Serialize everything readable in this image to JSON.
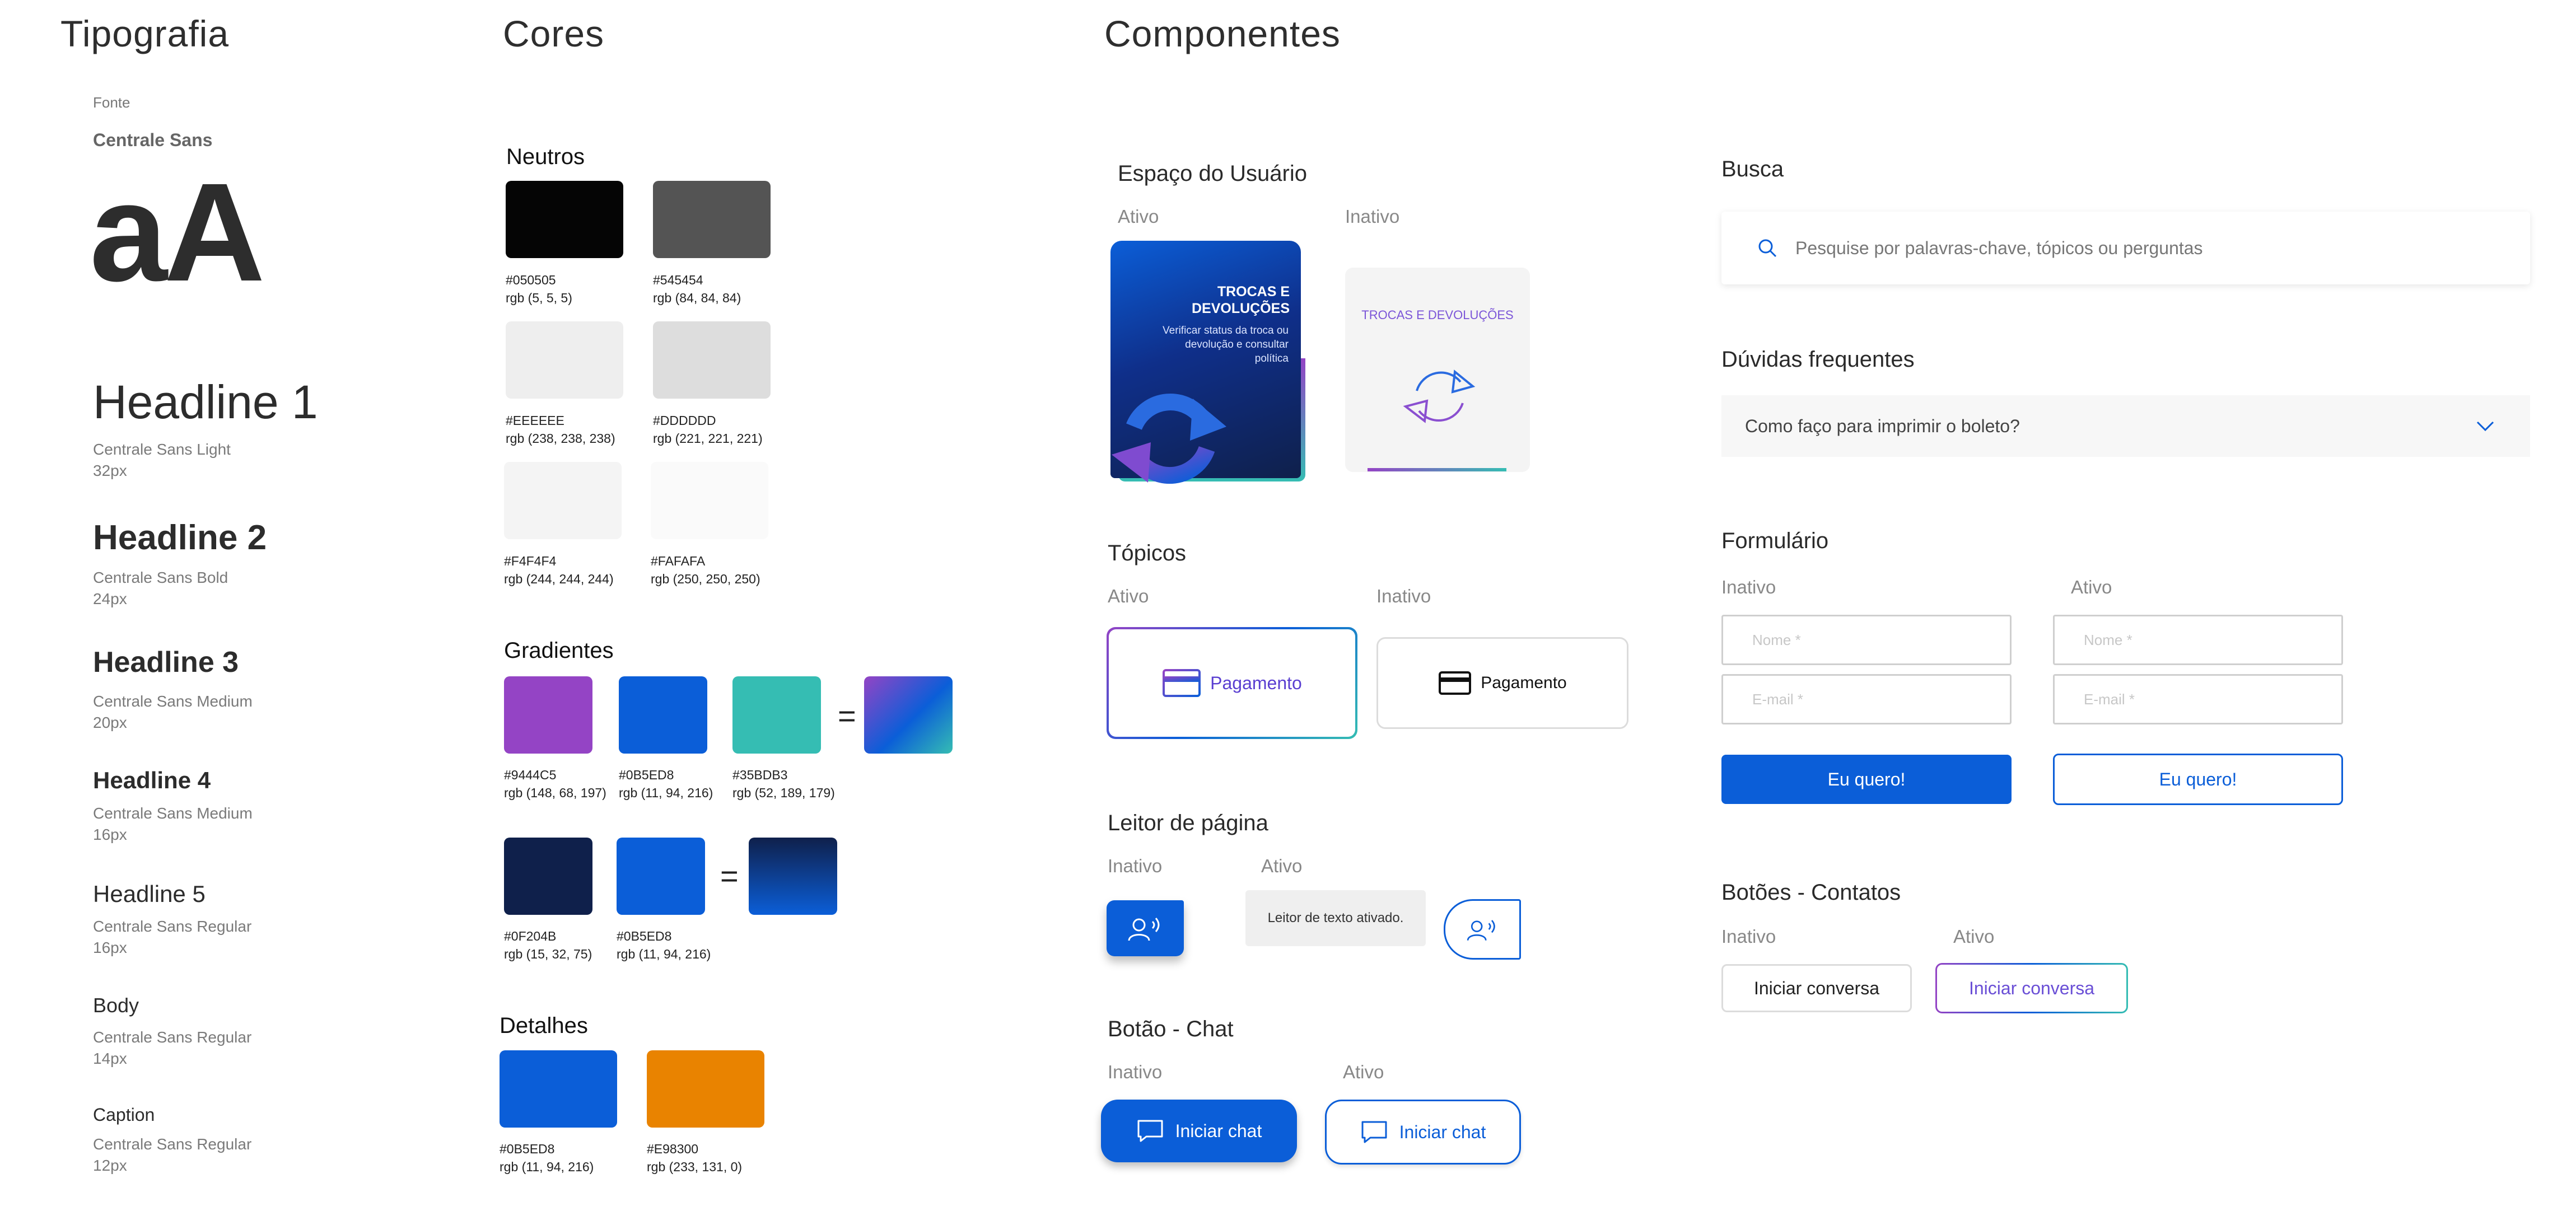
{
  "typography": {
    "title": "Tipografia",
    "font_label": "Fonte",
    "font_name": "Centrale Sans",
    "specimen": "aA",
    "styles": [
      {
        "name": "Headline 1",
        "weight": "Centrale Sans Light",
        "size": "32px"
      },
      {
        "name": "Headline 2",
        "weight": "Centrale Sans Bold",
        "size": "24px"
      },
      {
        "name": "Headline 3",
        "weight": "Centrale Sans Medium",
        "size": "20px"
      },
      {
        "name": "Headline 4",
        "weight": "Centrale Sans Medium",
        "size": "16px"
      },
      {
        "name": "Headline 5",
        "weight": "Centrale Sans Regular",
        "size": "16px"
      },
      {
        "name": "Body",
        "weight": "Centrale Sans Regular",
        "size": "14px"
      },
      {
        "name": "Caption",
        "weight": "Centrale Sans Regular",
        "size": "12px"
      }
    ]
  },
  "colors": {
    "title": "Cores",
    "neutrals_title": "Neutros",
    "neutrals": [
      {
        "hex": "#050505",
        "rgb": "rgb (5, 5, 5)",
        "color": "#050505"
      },
      {
        "hex": "#545454",
        "rgb": "rgb (84, 84, 84)",
        "color": "#545454"
      },
      {
        "hex": "#EEEEEE",
        "rgb": "rgb (238, 238, 238)",
        "color": "#EEEEEE"
      },
      {
        "hex": "#DDDDDD",
        "rgb": "rgb (221, 221, 221)",
        "color": "#DDDDDD"
      },
      {
        "hex": "#F4F4F4",
        "rgb": "rgb (244, 244, 244)",
        "color": "#F4F4F4"
      },
      {
        "hex": "#FAFAFA",
        "rgb": "rgb (250, 250, 250)",
        "color": "#FAFAFA"
      }
    ],
    "gradients_title": "Gradientes",
    "gradient1": [
      {
        "hex": "#9444C5",
        "rgb": "rgb (148, 68, 197)",
        "color": "#9444C5"
      },
      {
        "hex": "#0B5ED8",
        "rgb": "rgb (11, 94, 216)",
        "color": "#0B5ED8"
      },
      {
        "hex": "#35BDB3",
        "rgb": "rgb (52, 189, 179)",
        "color": "#35BDB3"
      }
    ],
    "gradient2": [
      {
        "hex": "#0F204B",
        "rgb": "rgb (15, 32, 75)",
        "color": "#0F204B"
      },
      {
        "hex": "#0B5ED8",
        "rgb": "rgb (11, 94, 216)",
        "color": "#0B5ED8"
      }
    ],
    "equals": "=",
    "details_title": "Detalhes",
    "details": [
      {
        "hex": "#0B5ED8",
        "rgb": "rgb (11, 94, 216)",
        "color": "#0B5ED8"
      },
      {
        "hex": "#E98300",
        "rgb": "rgb (233, 131, 0)",
        "color": "#E98300"
      }
    ]
  },
  "components": {
    "title": "Componentes",
    "user_space": {
      "title": "Espaço do Usuário",
      "active": "Ativo",
      "inactive": "Inativo",
      "card_title": "TROCAS E DEVOLUÇÕES",
      "card_text": "Verificar status da troca ou devolução e consultar política",
      "card_title_inactive": "TROCAS E DEVOLUÇÕES"
    },
    "topics": {
      "title": "Tópicos",
      "active": "Ativo",
      "inactive": "Inativo",
      "label_active": "Pagamento",
      "label_inactive": "Pagamento"
    },
    "reader": {
      "title": "Leitor de página",
      "inactive": "Inativo",
      "active": "Ativo",
      "tooltip": "Leitor de texto ativado."
    },
    "chat": {
      "title": "Botão - Chat",
      "inactive": "Inativo",
      "active": "Ativo",
      "label_inactive": "Iniciar chat",
      "label_active": "Iniciar chat"
    },
    "search": {
      "title": "Busca",
      "placeholder": "Pesquise por palavras-chave, tópicos ou perguntas"
    },
    "faq": {
      "title": "Dúvidas frequentes",
      "question": "Como faço para imprimir o boleto?"
    },
    "form": {
      "title": "Formulário",
      "inactive": "Inativo",
      "active": "Ativo",
      "name_placeholder": "Nome *",
      "email_placeholder": "E-mail *",
      "button_label": "Eu quero!"
    },
    "contact": {
      "title": "Botões - Contatos",
      "inactive": "Inativo",
      "active": "Ativo",
      "label_inactive": "Iniciar conversa",
      "label_active": "Iniciar conversa"
    }
  },
  "accent": {
    "blue": "#0B5ED8",
    "purple": "#9444C5",
    "teal": "#35BDB3",
    "navy": "#0F204B",
    "orange": "#E98300"
  }
}
